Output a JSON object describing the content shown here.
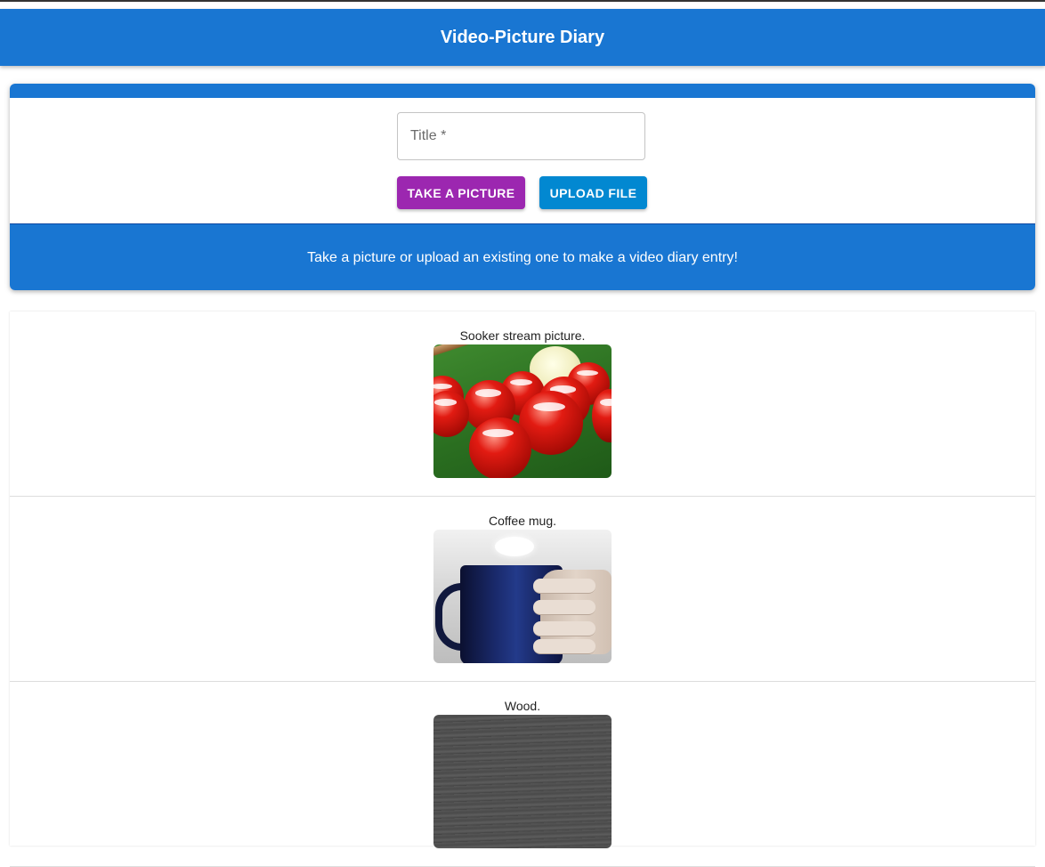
{
  "app": {
    "title": "Video-Picture Diary"
  },
  "form": {
    "title_placeholder": "Title *",
    "title_value": "",
    "take_picture_label": "Take a picture",
    "upload_file_label": "Upload file",
    "hint": "Take a picture or upload an existing one to make a video diary entry!"
  },
  "entries": [
    {
      "caption": "Sooker stream picture."
    },
    {
      "caption": "Coffee mug."
    },
    {
      "caption": "Wood."
    }
  ],
  "colors": {
    "primary": "#1976d2",
    "secondary": "#9c27b0",
    "upload": "#0288d1"
  }
}
